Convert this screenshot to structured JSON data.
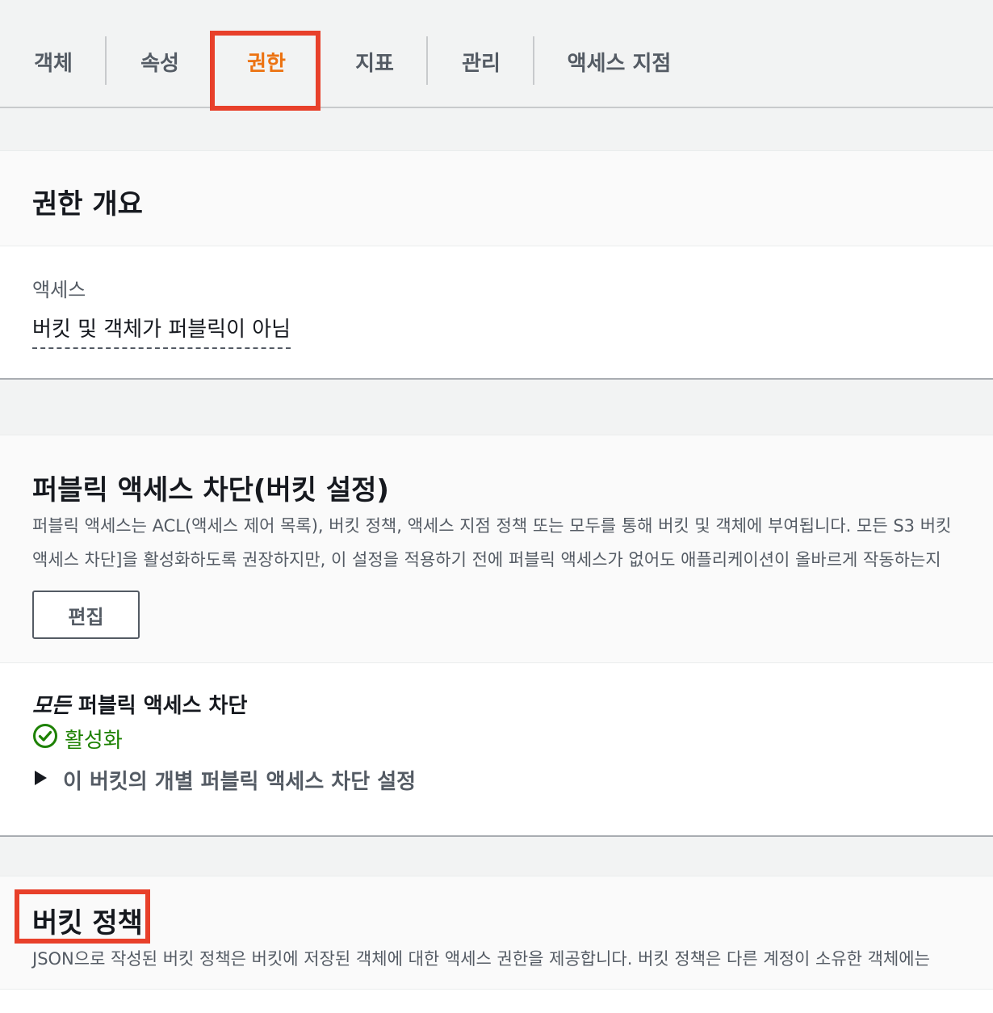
{
  "tabs": [
    {
      "label": "객체"
    },
    {
      "label": "속성"
    },
    {
      "label": "권한"
    },
    {
      "label": "지표"
    },
    {
      "label": "관리"
    },
    {
      "label": "액세스 지점"
    }
  ],
  "active_tab": "권한",
  "colors": {
    "accent": "#ec7211",
    "highlight": "#e8402a",
    "success": "#1d8102"
  },
  "overview": {
    "title": "권한 개요",
    "access_label": "액세스",
    "access_value": "버킷 및 객체가 퍼블릭이 아님"
  },
  "block_public": {
    "title": "퍼블릭 액세스 차단(버킷 설정)",
    "desc_line1": "퍼블릭 액세스는 ACL(액세스 제어 목록), 버킷 정책, 액세스 지점 정책 또는 모두를 통해 버킷 및 객체에 부여됩니다. 모든 S3 버킷",
    "desc_line2": "액세스 차단]을 활성화하도록 권장하지만, 이 설정을 적용하기 전에 퍼블릭 액세스가 없어도 애플리케이션이 올바르게 작동하는지",
    "edit_label": "편집",
    "all_block_em": "모든",
    "all_block_rest": " 퍼블릭 액세스 차단",
    "status_label": "활성화",
    "status_icon": "check-circle-icon",
    "expander_label": "이 버킷의 개별 퍼블릭 액세스 차단 설정"
  },
  "bucket_policy": {
    "title": "버킷 정책",
    "desc": "JSON으로 작성된 버킷 정책은 버킷에 저장된 객체에 대한 액세스 권한을 제공합니다. 버킷 정책은 다른 계정이 소유한 객체에는"
  }
}
